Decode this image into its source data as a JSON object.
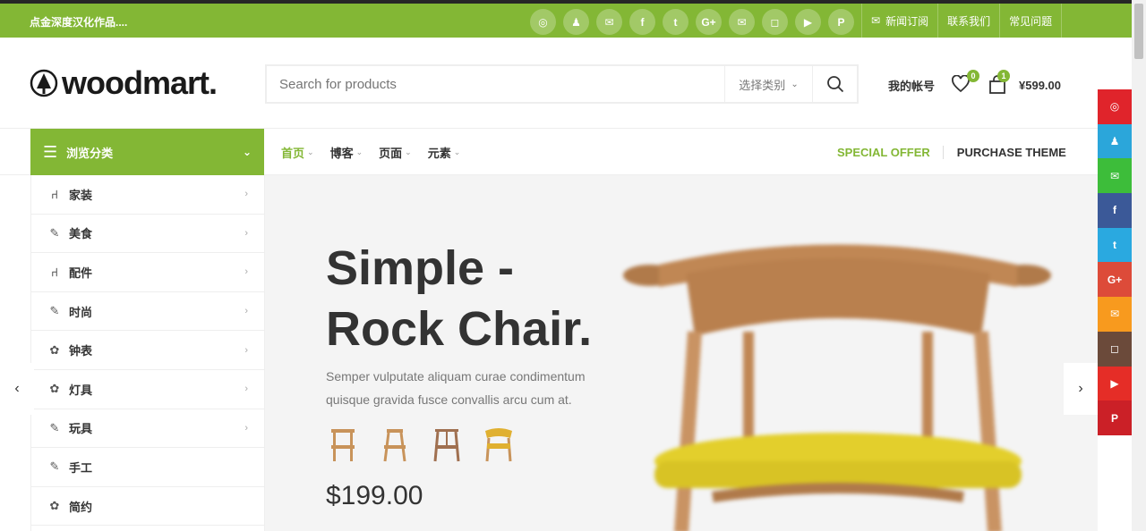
{
  "topbar": {
    "text": "点金深度汉化作品....",
    "socials": [
      {
        "icon": "weibo-icon",
        "glyph": "◎"
      },
      {
        "icon": "qq-icon",
        "glyph": "♟"
      },
      {
        "icon": "wechat-icon",
        "glyph": "✉"
      },
      {
        "icon": "facebook-icon",
        "glyph": "f"
      },
      {
        "icon": "twitter-icon",
        "glyph": "t"
      },
      {
        "icon": "google-plus-icon",
        "glyph": "G+"
      },
      {
        "icon": "email-icon",
        "glyph": "✉"
      },
      {
        "icon": "instagram-icon",
        "glyph": "◻"
      },
      {
        "icon": "youtube-icon",
        "glyph": "▶"
      },
      {
        "icon": "pinterest-icon",
        "glyph": "P"
      }
    ],
    "links": [
      "新闻订阅",
      "联系我们",
      "常见问题"
    ]
  },
  "header": {
    "logo": "woodmart.",
    "search_placeholder": "Search for products",
    "category_label": "选择类别",
    "account": "我的帐号",
    "wishlist_count": "0",
    "cart_count": "1",
    "cart_total": "¥599.00"
  },
  "nav": {
    "browse": "浏览分类",
    "items": [
      "首页",
      "博客",
      "页面",
      "元素"
    ],
    "special": "SPECIAL OFFER",
    "purchase": "PURCHASE THEME"
  },
  "categories": [
    "家装",
    "美食",
    "配件",
    "时尚",
    "钟表",
    "灯具",
    "玩具",
    "手工",
    "简约"
  ],
  "category_has_arrow": [
    true,
    true,
    true,
    true,
    true,
    true,
    true,
    false,
    false
  ],
  "hero": {
    "title_line1": "Simple -",
    "title_line2": "Rock Chair.",
    "subtitle": "Semper vulputate aliquam curae condimentum quisque gravida fusce convallis arcu cum at.",
    "price": "$199.00"
  },
  "colors": {
    "brand": "#83b735",
    "share": [
      "#e0242b",
      "#2ba6da",
      "#3dbd3a",
      "#3b5998",
      "#2aa9e0",
      "#dd4b39",
      "#f89a1e",
      "#6b4a3a",
      "#e52d27",
      "#cb2027"
    ]
  }
}
